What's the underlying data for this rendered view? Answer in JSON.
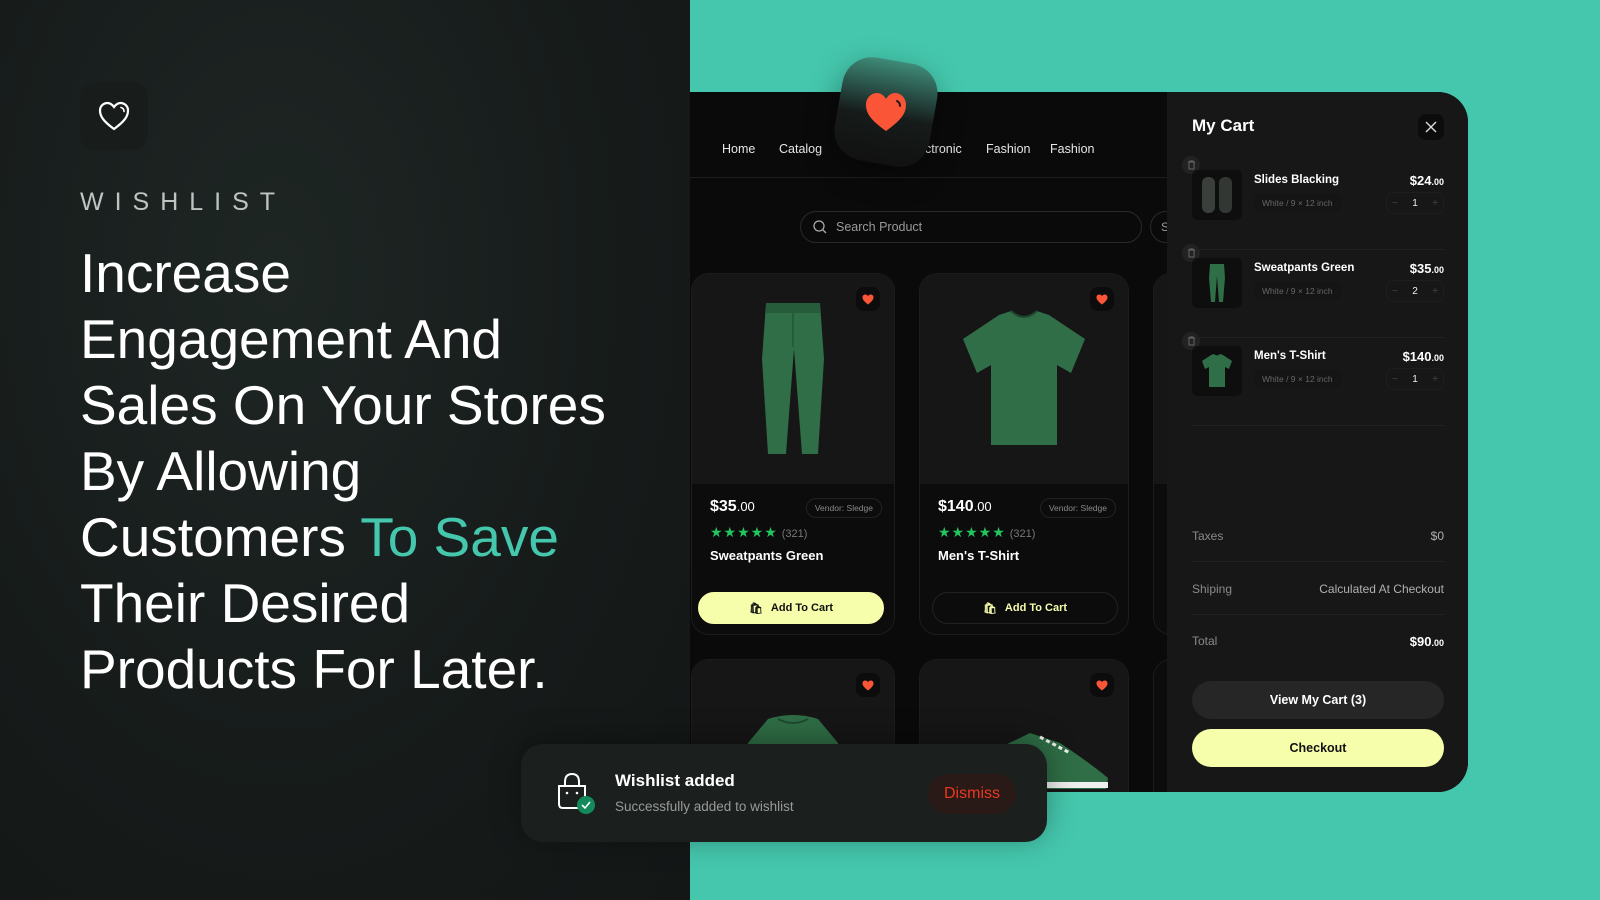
{
  "colors": {
    "accent": "#45c7ad",
    "heart": "#fb5537",
    "cta": "#f6fdab",
    "star": "#22c55e",
    "dismiss": "#e8391f"
  },
  "hero": {
    "logo_icon": "heart-outline-icon",
    "brand": "WISHLIST",
    "lines": [
      "Increase",
      "Engagement And",
      "Sales On Your Stores",
      "By Allowing"
    ],
    "line5_pre": "Customers ",
    "line5_highlight": "To Save",
    "lines_after": [
      "Their Desired",
      "Products For Later."
    ]
  },
  "nav": {
    "items": [
      "Home",
      "Catalog",
      "Fa",
      "ectronic",
      "Fashion",
      "Fashion"
    ],
    "active_index": 2
  },
  "search": {
    "placeholder": "Search Product",
    "second_label": "S"
  },
  "products": [
    {
      "name": "Sweatpants Green",
      "price": "$35",
      "cents": ".00",
      "vendor": "Vendor: Sledge",
      "rating": 5,
      "reviews": "(321)",
      "button": "Add To Cart",
      "button_style": "primary"
    },
    {
      "name": "Men's T-Shirt",
      "price": "$140",
      "cents": ".00",
      "vendor": "Vendor: Sledge",
      "rating": 5,
      "reviews": "(321)",
      "button": "Add To Cart",
      "button_style": "ghost"
    }
  ],
  "cart": {
    "title": "My Cart",
    "items": [
      {
        "name": "Slides Blacking",
        "variant": "White / 9 × 12 inch",
        "price": "$24",
        "cents": ".00",
        "qty": "1"
      },
      {
        "name": "Sweatpants Green",
        "variant": "White / 9 × 12 inch",
        "price": "$35",
        "cents": ".00",
        "qty": "2"
      },
      {
        "name": "Men's T-Shirt",
        "variant": "White / 9 × 12 inch",
        "price": "$140",
        "cents": ".00",
        "qty": "1"
      }
    ],
    "taxes_label": "Taxes",
    "taxes_value": "$0",
    "shipping_label": "Shiping",
    "shipping_value": "Calculated At Checkout",
    "total_label": "Total",
    "total_value": "$90",
    "total_cents": ".00",
    "view_button": "View My Cart (3)",
    "checkout_button": "Checkout"
  },
  "toast": {
    "title": "Wishlist added",
    "subtitle": "Successfully added to wishlist",
    "dismiss": "Dismiss"
  }
}
